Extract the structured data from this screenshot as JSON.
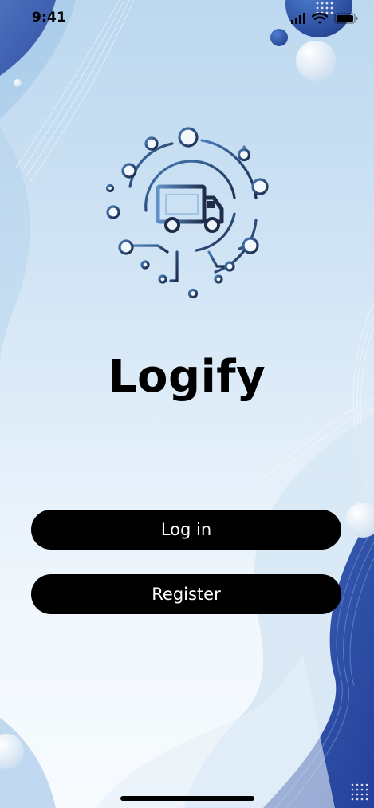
{
  "status_bar": {
    "time": "9:41",
    "icons": [
      "cellular-signal-icon",
      "wifi-icon",
      "battery-icon"
    ]
  },
  "logo": {
    "icon": "delivery-truck-circuit-icon"
  },
  "app": {
    "title": "Logify"
  },
  "actions": {
    "login_label": "Log in",
    "register_label": "Register"
  },
  "colors": {
    "background_top": "#bcd8ef",
    "background_bottom": "#f7fbfe",
    "accent_blue": "#2f4fa0",
    "logo_dark": "#1f2d4a",
    "logo_blue": "#2f5b8f",
    "button": "#000000",
    "button_text": "#ffffff"
  }
}
